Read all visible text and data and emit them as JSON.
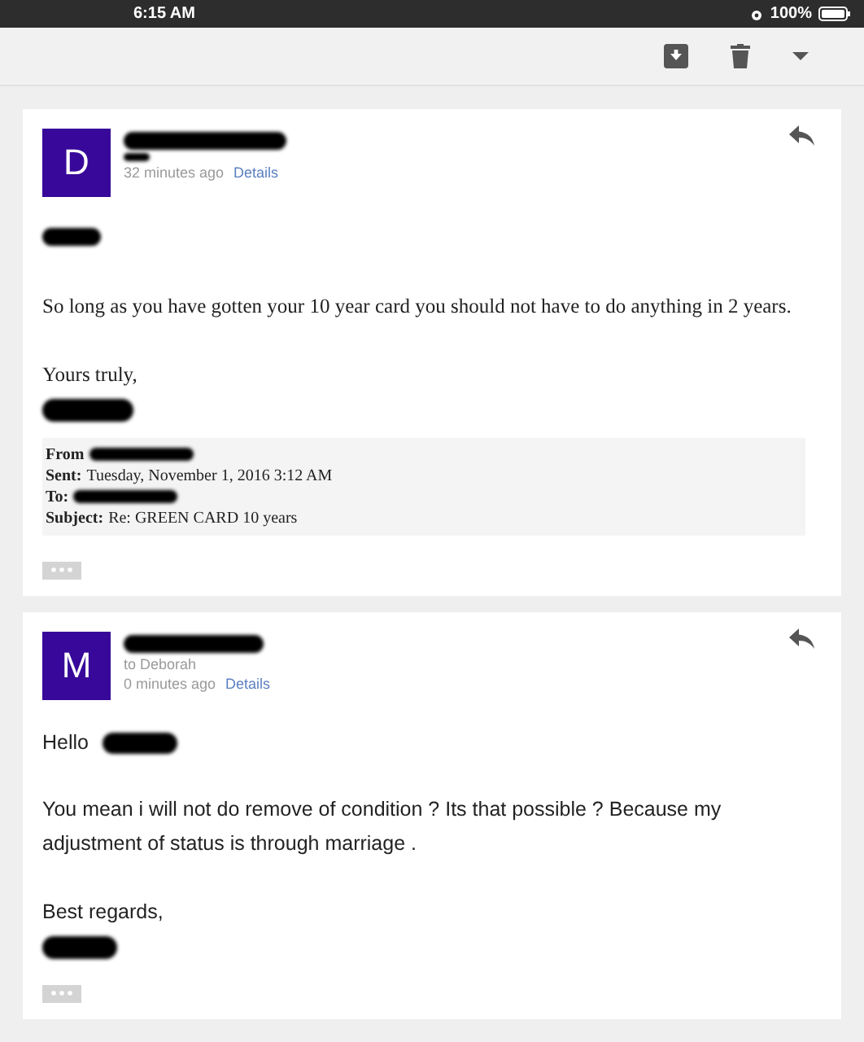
{
  "status_bar": {
    "time": "6:15 AM",
    "battery": "100%"
  },
  "messages": [
    {
      "kind": "quoted",
      "avatar_letter": "D",
      "time": "32 minutes ago",
      "details_link": "Details",
      "body": [
        {
          "kind": "redacted"
        },
        {
          "kind": "text",
          "text": "So long as you have gotten your 10 year card you should not have to do anything in 2 years."
        },
        {
          "kind": "closing",
          "text": "Yours truly,"
        },
        {
          "kind": "quote",
          "lines": [
            {
              "label": "From",
              "value_redacted": true
            },
            {
              "label": "Sent:",
              "value": "Tuesday, November 1, 2016 3:12 AM"
            },
            {
              "label": "To:",
              "value_redacted": true
            },
            {
              "label": "Subject:",
              "value": "Re: GREEN CARD 10 years"
            }
          ]
        }
      ]
    },
    {
      "kind": "plain",
      "avatar_letter": "M",
      "recipient": "to Deborah",
      "time": "0 minutes ago",
      "details_link": "Details",
      "body": [
        {
          "kind": "text",
          "text": "Hello",
          "redacted_after": true
        },
        {
          "kind": "text",
          "text": "You mean i will not do remove of condition ? Its that possible ? Because my adjustment of status is through marriage ."
        },
        {
          "kind": "closing",
          "text": "Best regards,"
        }
      ]
    }
  ]
}
